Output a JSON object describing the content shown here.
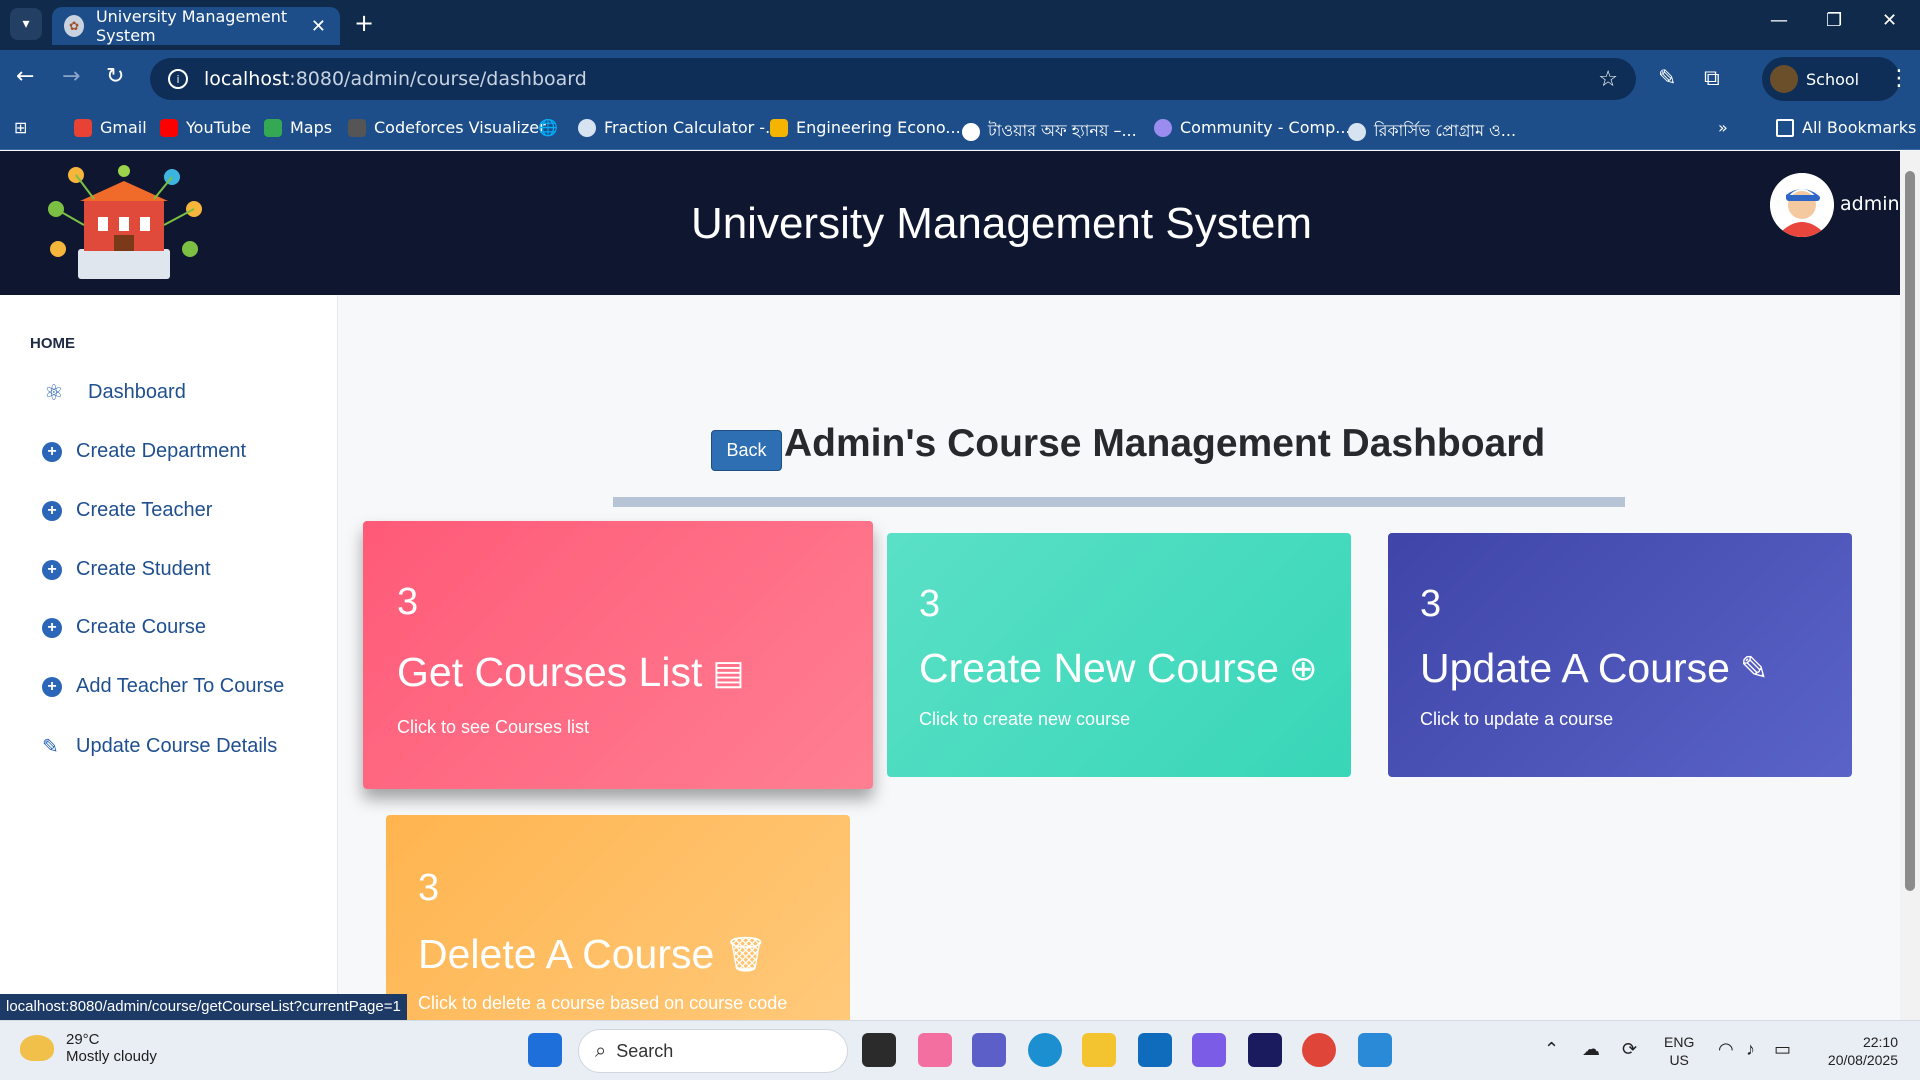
{
  "browser": {
    "tab_title": "University Management System",
    "url_host": "localhost",
    "url_path": ":8080/admin/course/dashboard",
    "profile_name": "School",
    "bookmarks": [
      "Gmail",
      "YouTube",
      "Maps",
      "Codeforces Visualizer",
      "Fraction Calculator -...",
      "Engineering Econo...",
      "টাওয়ার অফ হ্যানয় –...",
      "Community - Comp...",
      "রিকার্সিভ প্রোগ্রাম ও..."
    ],
    "all_bookmarks": "All Bookmarks"
  },
  "header": {
    "title": "University Management System",
    "user": "admin"
  },
  "sidebar": {
    "heading": "HOME",
    "items": [
      {
        "label": "Dashboard",
        "icon": "atom-icon"
      },
      {
        "label": "Create Department",
        "icon": "plus-circle-icon"
      },
      {
        "label": "Create Teacher",
        "icon": "plus-circle-icon"
      },
      {
        "label": "Create Student",
        "icon": "plus-circle-icon"
      },
      {
        "label": "Create Course",
        "icon": "plus-circle-icon"
      },
      {
        "label": "Add Teacher To Course",
        "icon": "plus-circle-icon"
      },
      {
        "label": "Update Course Details",
        "icon": "edit-icon"
      }
    ]
  },
  "main": {
    "back_label": "Back",
    "title": "Admin's Course Management Dashboard",
    "cards": [
      {
        "count": "3",
        "title": "Get Courses List",
        "subtitle": "Click to see Courses list",
        "icon": "book-icon",
        "color": "#ff6a84"
      },
      {
        "count": "3",
        "title": "Create New Course",
        "subtitle": "Click to create new course",
        "icon": "plus-circle-icon",
        "color": "#48dcc0"
      },
      {
        "count": "3",
        "title": "Update A Course",
        "subtitle": "Click to update a course",
        "icon": "edit-icon",
        "color": "#4b52b8"
      },
      {
        "count": "3",
        "title": "Delete A Course",
        "subtitle": "Click to delete a course based on course code",
        "icon": "trash-icon",
        "color": "#ffbd62"
      }
    ]
  },
  "status_url": "localhost:8080/admin/course/getCourseList?currentPage=1",
  "taskbar": {
    "temp": "29°C",
    "weather": "Mostly cloudy",
    "search": "Search",
    "lang1": "ENG",
    "lang2": "US",
    "time": "22:10",
    "date": "20/08/2025"
  }
}
